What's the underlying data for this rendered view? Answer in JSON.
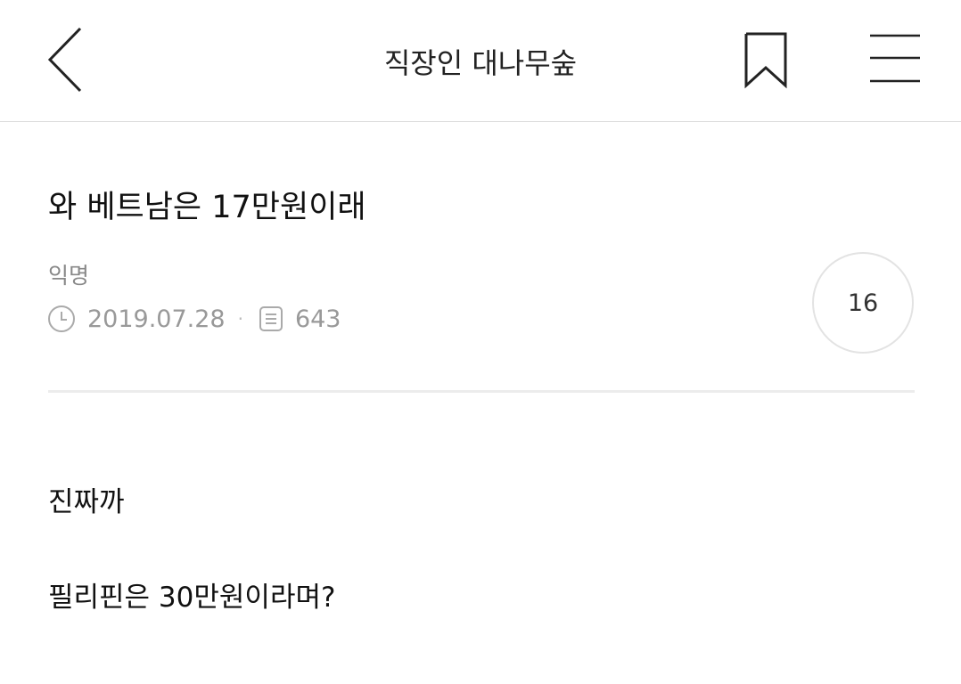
{
  "header": {
    "title": "직장인 대나무숲",
    "back_icon": "chevron-left-icon",
    "bookmark_icon": "bookmark-icon",
    "menu_icon": "hamburger-menu-icon"
  },
  "post": {
    "title": "와 베트남은 17만원이래",
    "author": "익명",
    "date": "2019.07.28",
    "separator": "·",
    "views": "643",
    "comment_count": "16",
    "body": [
      "진짜까",
      "필리핀은 30만원이라며?"
    ]
  },
  "colors": {
    "text_primary": "#111111",
    "text_secondary": "#888888",
    "divider": "#ececec",
    "border": "#dcdcdc"
  }
}
